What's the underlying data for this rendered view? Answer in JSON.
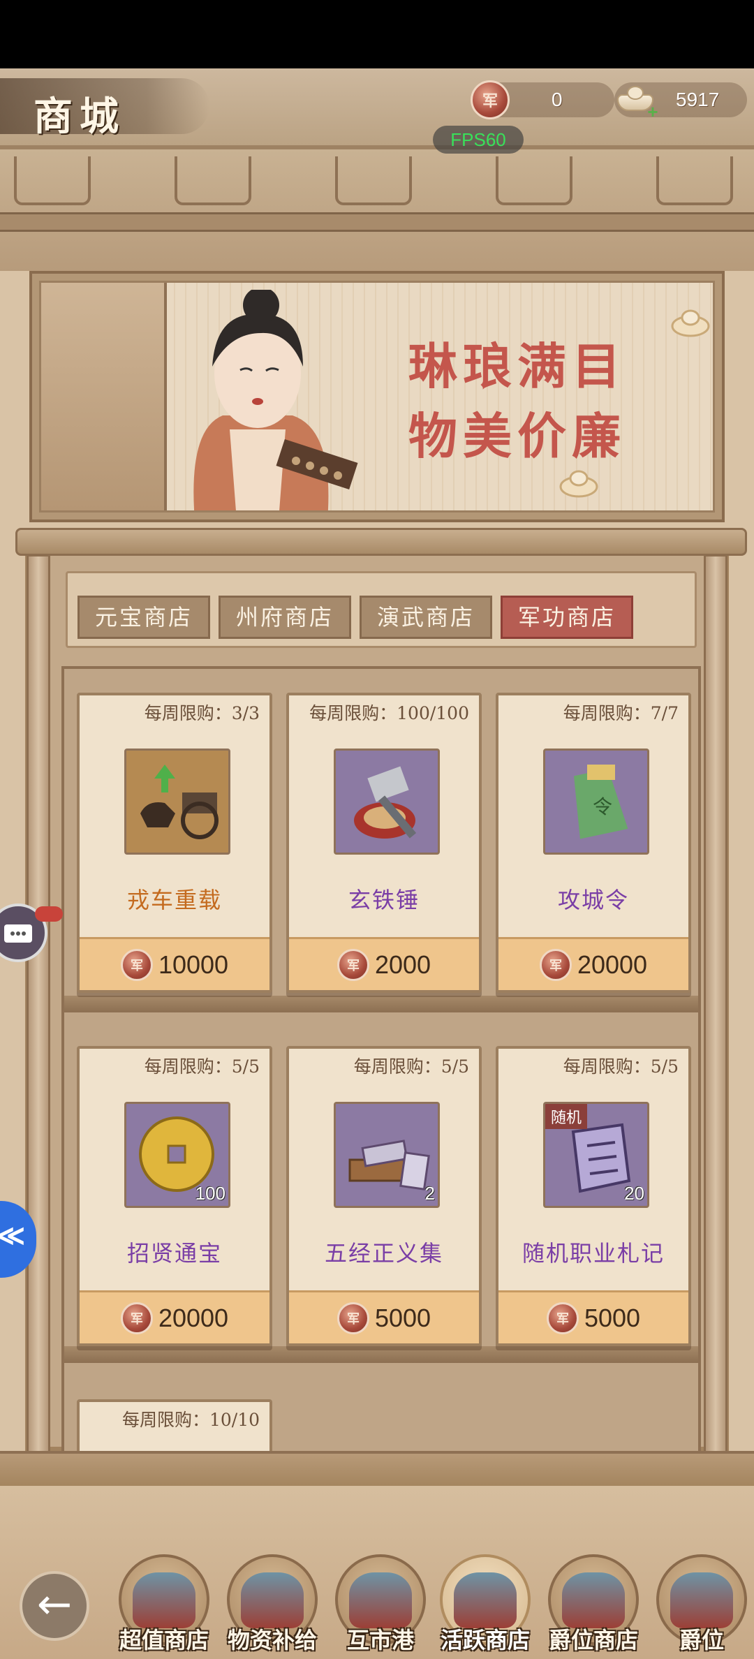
{
  "header": {
    "title": "商城",
    "currency_merit": "0",
    "currency_ingot": "5917",
    "fps": "FPS60",
    "coin_char": "军"
  },
  "banner": {
    "slogan_line1": "琳琅满目",
    "slogan_line2": "物美价廉"
  },
  "tabs": [
    {
      "label": "元宝商店",
      "active": false
    },
    {
      "label": "州府商店",
      "active": false
    },
    {
      "label": "演武商店",
      "active": false
    },
    {
      "label": "军功商店",
      "active": true
    }
  ],
  "items": [
    {
      "limit": "每周限购：3/3",
      "name": "戎车重载",
      "price": "10000",
      "qty": "",
      "icon": "chariot-icon",
      "tag": ""
    },
    {
      "limit": "每周限购：100/100",
      "name": "玄铁锤",
      "price": "2000",
      "qty": "",
      "icon": "hammer-icon",
      "tag": ""
    },
    {
      "limit": "每周限购：7/7",
      "name": "攻城令",
      "price": "20000",
      "qty": "",
      "icon": "siege-token-icon",
      "tag": ""
    },
    {
      "limit": "每周限购：5/5",
      "name": "招贤通宝",
      "price": "20000",
      "qty": "100",
      "icon": "coin-icon",
      "tag": ""
    },
    {
      "limit": "每周限购：5/5",
      "name": "五经正义集",
      "price": "5000",
      "qty": "2",
      "icon": "books-icon",
      "tag": ""
    },
    {
      "limit": "每周限购：5/5",
      "name": "随机职业札记",
      "price": "5000",
      "qty": "20",
      "icon": "scroll-icon",
      "tag": "随机"
    },
    {
      "limit": "每周限购：10/10",
      "name": "",
      "price": "",
      "qty": "",
      "icon": "",
      "tag": ""
    }
  ],
  "nav": [
    {
      "label": "超值商店",
      "active": false
    },
    {
      "label": "物资补给",
      "active": false
    },
    {
      "label": "互市港",
      "active": false
    },
    {
      "label": "活跃商店",
      "active": true
    },
    {
      "label": "爵位商店",
      "active": false
    },
    {
      "label": "爵位",
      "active": false
    }
  ],
  "side": {
    "blue_button_glyph": "≪"
  },
  "colors": {
    "active_tab": "#b65d53",
    "orange_name": "#c46a1e",
    "purple_name": "#7a3ea6",
    "price_bg": "#efc58c"
  }
}
